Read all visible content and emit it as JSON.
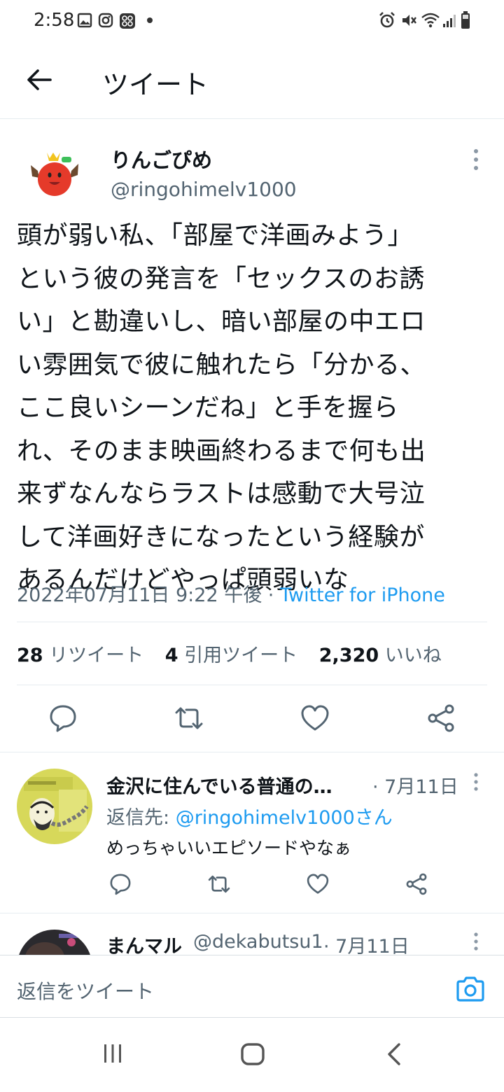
{
  "status_bar": {
    "time": "2:58",
    "left_icons": [
      "gallery-icon",
      "instagram-icon",
      "app-grid-icon",
      "dot-icon"
    ],
    "right_icons": [
      "alarm-icon",
      "mute-icon",
      "wifi-icon",
      "signal-icon",
      "battery-icon"
    ]
  },
  "header": {
    "back_icon": "arrow-left-icon",
    "title": "ツイート"
  },
  "tweet": {
    "author_name": "りんごぴめ",
    "author_handle": "@ringohimelv1000",
    "text": "頭が弱い私、「部屋で洋画みよう」\nという彼の発言を「セックスのお誘\nい」と勘違いし、暗い部屋の中エロ\nい雰囲気で彼に触れたら「分かる、\nここ良いシーンだね」と手を握ら\nれ、そのまま映画終わるまで何も出\n来ずなんならラストは感動で大号泣\nして洋画好きになったという経験が\nあるんだけどやっぱ頭弱いな",
    "timestamp": "2022年07月11日 9:22 午後 · ",
    "source": "Twitter for iPhone",
    "stats": {
      "retweets_count": "28",
      "retweets_label": "リツイート",
      "quotes_count": "4",
      "quotes_label": "引用ツイート",
      "likes_count": "2,320",
      "likes_label": "いいね"
    }
  },
  "replies": [
    {
      "name": "金沢に住んでいる普通の…",
      "date": "· 7月11日",
      "reply_to_prefix": "返信先: ",
      "reply_to_handle": "@ringohimelv1000さん",
      "text": "めっちゃいいエピソードやなぁ"
    },
    {
      "name": "まんマル",
      "handle": "@dekabutsu1",
      "date": "· 7月11日"
    }
  ],
  "compose": {
    "placeholder": "返信をツイート",
    "camera_icon": "camera-icon"
  },
  "colors": {
    "accent": "#1d9bf0",
    "secondary_text": "#536471",
    "primary_text": "#0f1419",
    "divider": "#e6ecf0"
  }
}
